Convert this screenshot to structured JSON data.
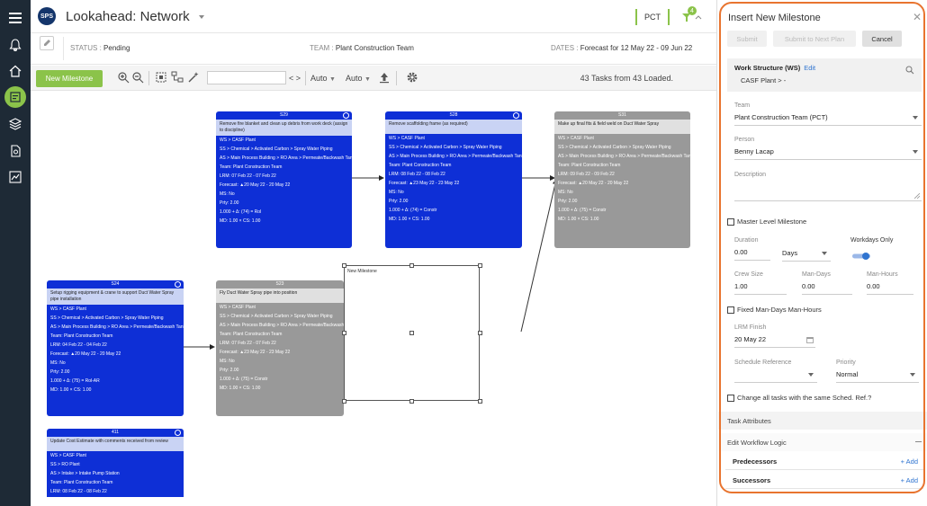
{
  "colors": {
    "rail": "#1e2a36",
    "accent": "#8bc34a",
    "task_blue": "#0e2fd6",
    "task_gray": "#999999",
    "link": "#2f74d0",
    "highlight": "#e8742f"
  },
  "rail": {
    "icons": [
      "menu-icon",
      "bell-icon",
      "home-icon",
      "schedule-icon",
      "layers-icon",
      "document-icon",
      "chart-icon"
    ]
  },
  "header": {
    "logo": "SPS",
    "title": "Lookahead: Network",
    "badge": "PCT",
    "filter_count": "4"
  },
  "info": {
    "status_label": "STATUS",
    "status_value": "Pending",
    "team_label": "TEAM",
    "team_value": "Plant Construction Team",
    "dates_label": "DATES",
    "dates_value": "Forecast for 12 May 22 - 09 Jun 22"
  },
  "toolbar": {
    "new_milestone": "New Milestone",
    "nav": "< >",
    "auto1": "Auto",
    "auto2": "Auto",
    "tasks_loaded": "43 Tasks from 43 Loaded."
  },
  "cards": [
    {
      "id": "S29",
      "name": "Remove fire blanket and clean up debris from work deck (assign to discipline)",
      "color": "blue",
      "fields": [
        "WS > CASF Plant",
        "SS > Chemical > Activated Carbon > Spray Water Piping",
        "AS > Main Process Building > RO Area > Permeate/Backwash Tanks",
        "Team: Plant Construction Team",
        "LRM: 07 Feb 22 - 07 Feb 22",
        "Forecast: ▲20 May 22 - 20 May 22",
        "MS: No",
        "Prty: 2.00",
        "1.000 + Δ: (74) = Rol",
        "MD: 1.00 × CS: 1.00"
      ]
    },
    {
      "id": "S28",
      "name": "Remove scaffolding frame (as required)",
      "color": "blue",
      "fields": [
        "WS > CASF Plant",
        "SS > Chemical > Activated Carbon > Spray Water Piping",
        "AS > Main Process Building > RO Area > Permeate/Backwash Tanks",
        "Team: Plant Construction Team",
        "LRM: 08 Feb 22 - 08 Feb 22",
        "Forecast: ▲23 May 22 - 23 May 22",
        "MS: No",
        "Prty: 2.00",
        "1.000 + Δ: (74) = Constr",
        "MD: 1.00 × CS: 1.00"
      ]
    },
    {
      "id": "S31",
      "name": "Make up final fits & field weld on Duct Water Spray",
      "color": "gray",
      "fields": [
        "WS > CASF Plant",
        "SS > Chemical > Activated Carbon > Spray Water Piping",
        "AS > Main Process Building > RO Area > Permeate/Backwash Tanks",
        "Team: Plant Construction Team",
        "LRM: 09 Feb 22 - 09 Feb 22",
        "Forecast: ▲20 May 22 - 20 May 22",
        "MS: No",
        "Prty: 2.00",
        "1.000 + Δ: (75) = Constr",
        "MD: 1.00 × CS: 1.00"
      ]
    },
    {
      "id": "S24",
      "name": "Setup rigging equipment & crane to support Duct Water Spray pipe installation",
      "color": "blue",
      "fields": [
        "WS > CASF Plant",
        "SS > Chemical > Activated Carbon > Spray Water Piping",
        "AS > Main Process Building > RO Area > Permeate/Backwash Tanks",
        "Team: Plant Construction Team",
        "LRM: 04 Feb 22 - 04 Feb 22",
        "Forecast: ▲20 May 22 - 20 May 22",
        "MS: No",
        "Prty: 2.00",
        "1.000 + Δ: (75) = Rol-AR",
        "MD: 1.00 × CS: 1.00"
      ]
    },
    {
      "id": "S23",
      "name": "Fly Duct Water Spray pipe into position",
      "color": "gray",
      "fields": [
        "WS > CASF Plant",
        "SS > Chemical > Activated Carbon > Spray Water Piping",
        "AS > Main Process Building > RO Area > Permeate/Backwash Tanks",
        "Team: Plant Construction Team",
        "LRM: 07 Feb 22 - 07 Feb 22",
        "Forecast: ▲23 May 22 - 23 May 22",
        "MS: No",
        "Prty: 2.00",
        "1.000 + Δ: (75) = Constr",
        "MD: 1.00 × CS: 1.00"
      ]
    },
    {
      "id": "411",
      "name": "Update Cost Estimate with comments received from review",
      "color": "blue",
      "fields": [
        "WS > CASF Plant",
        "SS > RO Plant",
        "AS > Intake > Intake Pump Station",
        "Team: Plant Construction Team",
        "LRM: 08 Feb 22 - 08 Feb 22"
      ]
    }
  ],
  "new_milestone_box": "New Milestone",
  "panel": {
    "title": "Insert New Milestone",
    "submit": "Submit",
    "submit_next": "Submit to Next Plan",
    "cancel": "Cancel",
    "ws_title": "Work Structure (WS)",
    "ws_edit": "Edit",
    "ws_value": "CASF Plant > -",
    "team_label": "Team",
    "team_value": "Plant Construction Team (PCT)",
    "person_label": "Person",
    "person_value": "Benny Lacap",
    "description_label": "Description",
    "master_level": "Master Level Milestone",
    "duration_label": "Duration",
    "duration_value": "0.00",
    "duration_unit": "Days",
    "workdays_label": "Workdays Only",
    "workdays_on": true,
    "crew_label": "Crew Size",
    "crew_value": "1.00",
    "mandays_label": "Man-Days",
    "mandays_value": "0.00",
    "manhours_label": "Man-Hours",
    "manhours_value": "0.00",
    "fixed_label": "Fixed Man-Days Man-Hours",
    "lrm_label": "LRM Finish",
    "lrm_value": "20 May 22",
    "sched_label": "Schedule Reference",
    "sched_value": "",
    "priority_label": "Priority",
    "priority_value": "Normal",
    "change_all": "Change all tasks with the same Sched. Ref.?",
    "task_attributes": "Task Attributes",
    "workflow_logic": "Edit Workflow Logic",
    "predecessors": "Predecessors",
    "successors": "Successors",
    "add": "+ Add"
  }
}
